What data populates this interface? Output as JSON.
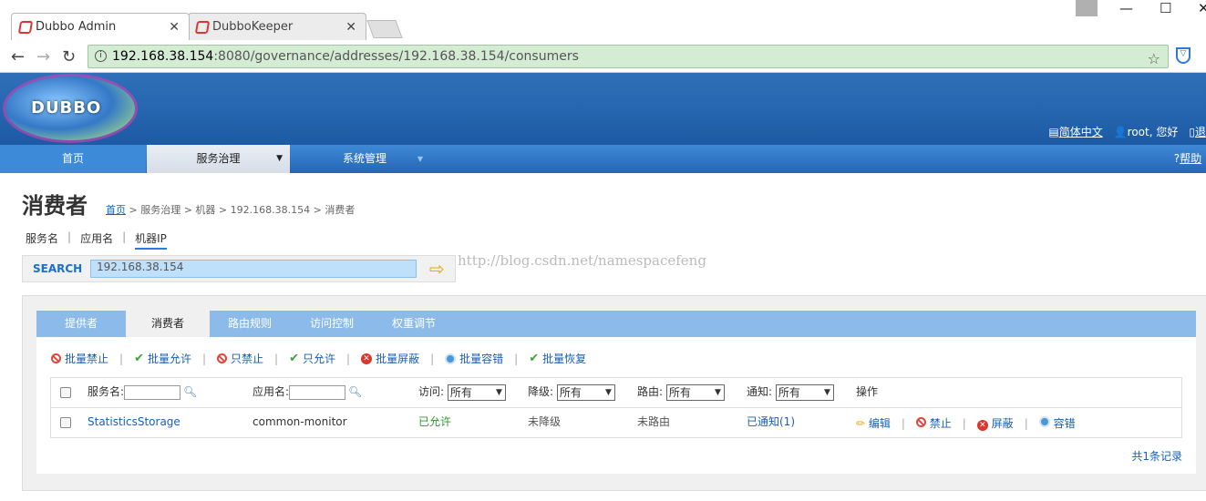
{
  "browser": {
    "tabs": [
      {
        "title": "Dubbo Admin"
      },
      {
        "title": "DubboKeeper"
      }
    ],
    "url_host": "192.168.38.154",
    "url_path": ":8080/governance/addresses/192.168.38.154/consumers"
  },
  "header": {
    "logo_text": "DUBBO",
    "language": "简体中文",
    "user": "root, 您好",
    "logout": "退"
  },
  "menu": {
    "home": "首页",
    "governance": "服务治理",
    "system": "系统管理",
    "help": "帮助"
  },
  "page": {
    "title": "消费者",
    "breadcrumb": {
      "home": "首页",
      "rest": "> 服务治理 > 机器 > 192.168.38.154 > 消费者"
    }
  },
  "search": {
    "tabs": [
      "服务名",
      "应用名",
      "机器IP"
    ],
    "label": "SEARCH",
    "value": "192.168.38.154"
  },
  "watermark": "http://blog.csdn.net/namespacefeng",
  "panel_tabs": [
    "提供者",
    "消费者",
    "路由规则",
    "访问控制",
    "权重调节"
  ],
  "actions": [
    "批量禁止",
    "批量允许",
    "只禁止",
    "只允许",
    "批量屏蔽",
    "批量容错",
    "批量恢复"
  ],
  "table": {
    "headers": {
      "service": "服务名:",
      "app": "应用名:",
      "access": "访问:",
      "degrade": "降级:",
      "route": "路由:",
      "notify": "通知:",
      "ops": "操作"
    },
    "filter_default": "所有",
    "rows": [
      {
        "service": "StatisticsStorage",
        "app": "common-monitor",
        "access": "已允许",
        "degrade": "未降级",
        "route": "未路由",
        "notify": "已通知(1)",
        "ops": [
          "编辑",
          "禁止",
          "屏蔽",
          "容错"
        ]
      }
    ]
  },
  "record_count": "共1条记录",
  "colors": {
    "banner": "#2f70b9",
    "menu": "#2466b6",
    "tabs": "#8dbbe9",
    "link": "#1a5fb4"
  }
}
